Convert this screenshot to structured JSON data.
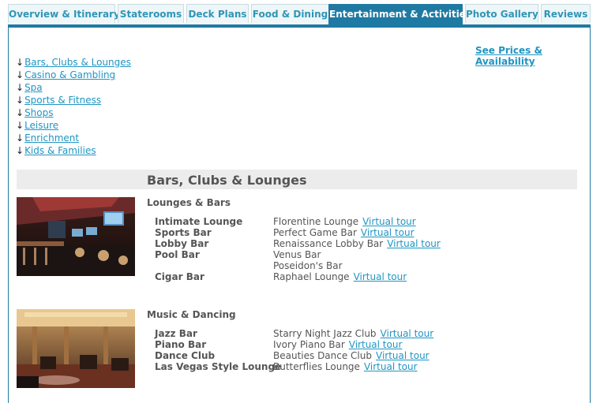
{
  "tabs": [
    {
      "label": "Overview & Itinerary",
      "active": false
    },
    {
      "label": "Staterooms",
      "active": false
    },
    {
      "label": "Deck Plans",
      "active": false
    },
    {
      "label": "Food & Dining",
      "active": false
    },
    {
      "label": "Entertainment & Activities",
      "active": true
    },
    {
      "label": "Photo Gallery",
      "active": false
    },
    {
      "label": "Reviews",
      "active": false
    }
  ],
  "see_prices": "See Prices & Availability",
  "anchor_arrow": "↓",
  "anchors": [
    "Bars, Clubs & Lounges",
    "Casino & Gambling",
    "Spa",
    "Sports & Fitness",
    "Shops",
    "Leisure",
    "Enrichment",
    "Kids & Families"
  ],
  "section_title": "Bars, Clubs & Lounges",
  "virtual_tour": "Virtual tour",
  "groups": [
    {
      "title": "Lounges & Bars",
      "rows": [
        {
          "venue": "Intimate Lounge",
          "place": "Florentine Lounge",
          "tour": true
        },
        {
          "venue": "Sports Bar",
          "place": "Perfect Game Bar",
          "tour": true
        },
        {
          "venue": "Lobby Bar",
          "place": "Renaissance Lobby Bar",
          "tour": true
        },
        {
          "venue": "Pool Bar",
          "place": "Venus Bar",
          "tour": false
        },
        {
          "venue": "",
          "place": "Poseidon's Bar",
          "tour": false
        },
        {
          "venue": "Cigar Bar",
          "place": "Raphael Lounge",
          "tour": true
        }
      ]
    },
    {
      "title": "Music & Dancing",
      "rows": [
        {
          "venue": "Jazz Bar",
          "place": "Starry Night Jazz Club",
          "tour": true
        },
        {
          "venue": "Piano Bar",
          "place": "Ivory Piano Bar",
          "tour": true
        },
        {
          "venue": "Dance Club",
          "place": "Beauties Dance Club",
          "tour": true
        },
        {
          "venue": "Las Vegas Style Lounge",
          "place": "Butterflies Lounge",
          "tour": true
        }
      ]
    }
  ]
}
